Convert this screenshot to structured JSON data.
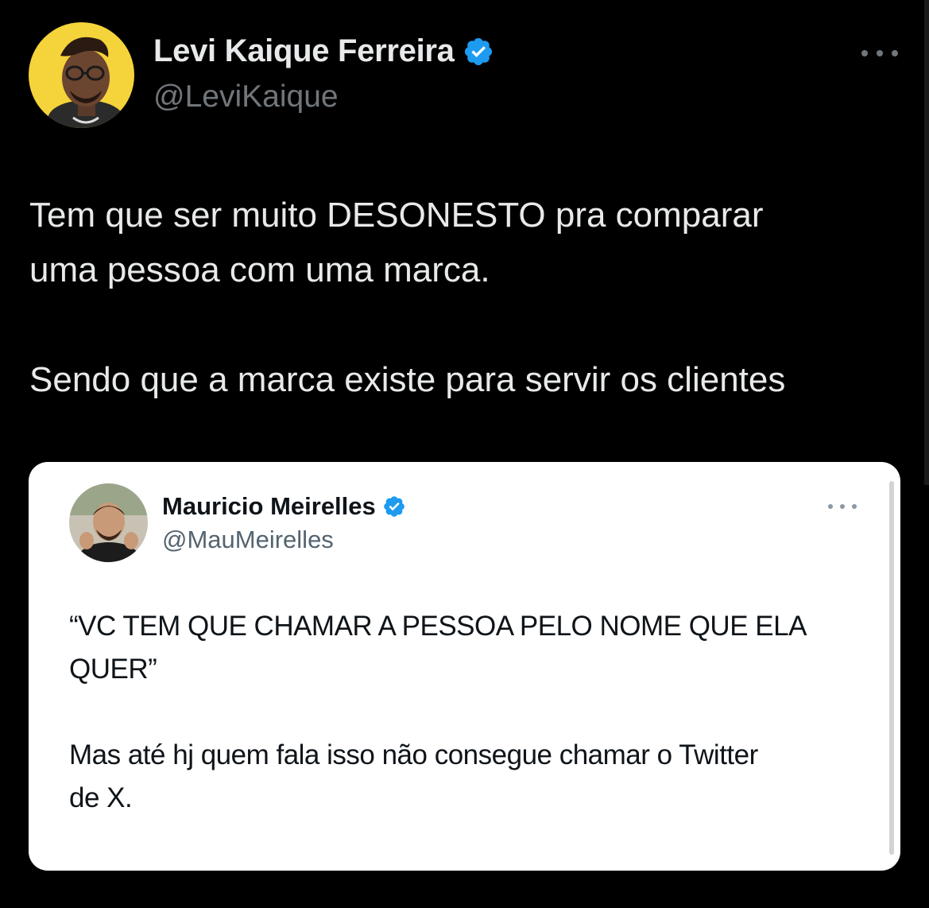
{
  "tweet": {
    "author": {
      "display_name": "Levi Kaique Ferreira",
      "handle": "@LeviKaique",
      "verified": true
    },
    "text": "Tem que ser muito DESONESTO pra comparar\numa pessoa com uma marca.\n\nSendo que a marca existe para servir os clientes",
    "menu_icon": "more-horizontal-icon"
  },
  "quoted_tweet": {
    "author": {
      "display_name": "Mauricio Meirelles",
      "handle": "@MauMeirelles",
      "verified": true
    },
    "text": "“VC TEM QUE CHAMAR A PESSOA PELO NOME QUE ELA\nQUER”\n\nMas até hj quem fala isso não consegue chamar o Twitter\nde X.",
    "menu_icon": "more-horizontal-icon"
  },
  "colors": {
    "background": "#000000",
    "primary_text": "#e7e9ea",
    "secondary_text": "#71767b",
    "verified_blue": "#1d9bf0",
    "card_background": "#ffffff"
  }
}
